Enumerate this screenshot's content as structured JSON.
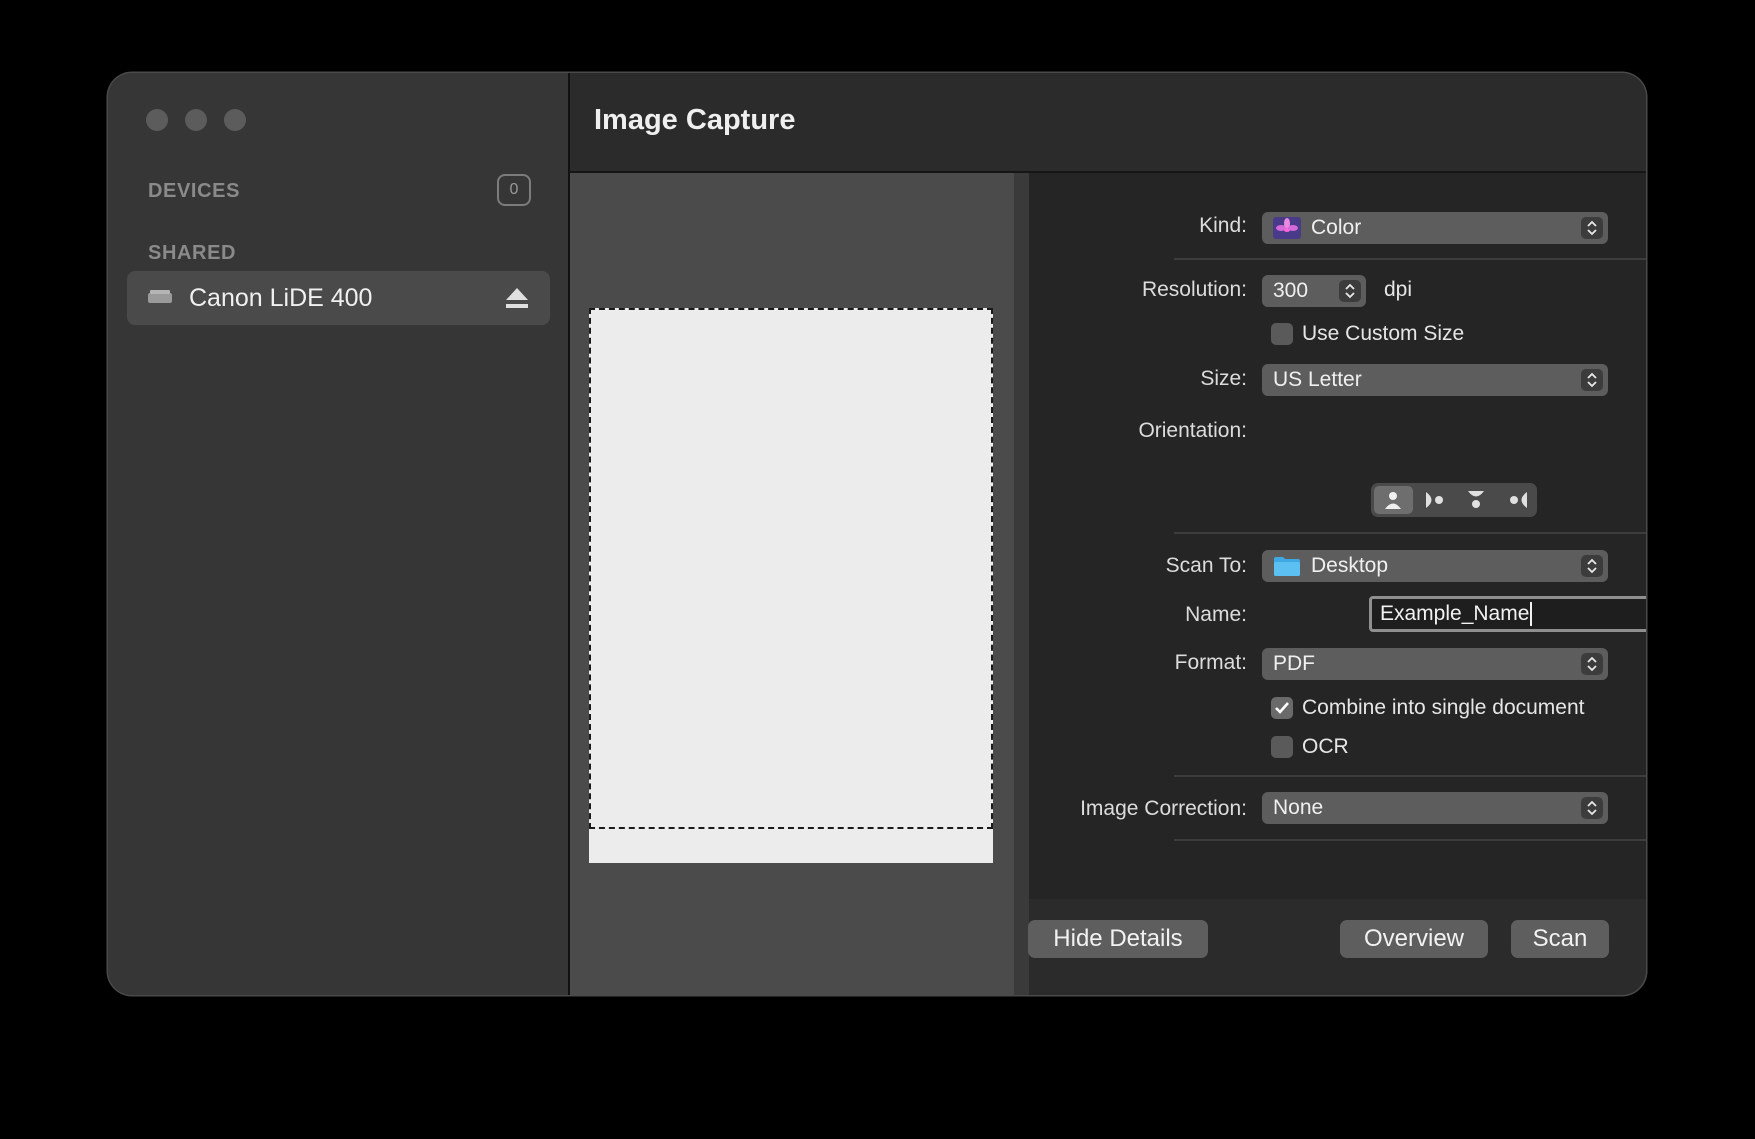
{
  "sidebar": {
    "devices_heading": "DEVICES",
    "devices_count": "0",
    "shared_heading": "SHARED",
    "device_name": "Canon LiDE 400"
  },
  "app": {
    "title": "Image Capture"
  },
  "settings": {
    "kind": {
      "label": "Kind:",
      "value": "Color"
    },
    "resolution": {
      "label": "Resolution:",
      "value": "300",
      "unit": "dpi"
    },
    "custom_size": {
      "label": "Use Custom Size",
      "checked": false
    },
    "size": {
      "label": "Size:",
      "value": "US Letter"
    },
    "orientation": {
      "label": "Orientation:",
      "selected_index": 0
    },
    "scan_to": {
      "label": "Scan To:",
      "value": "Desktop"
    },
    "name": {
      "label": "Name:",
      "value": "Example_Name"
    },
    "format": {
      "label": "Format:",
      "value": "PDF"
    },
    "combine": {
      "label": "Combine into single document",
      "checked": true
    },
    "ocr": {
      "label": "OCR",
      "checked": false
    },
    "image_correction": {
      "label": "Image Correction:",
      "value": "None"
    }
  },
  "buttons": {
    "hide_details": "Hide Details",
    "overview": "Overview",
    "scan": "Scan"
  },
  "colors": {
    "folder_blue": "#3fa9e6",
    "window_bg": "#2b2b2b"
  }
}
